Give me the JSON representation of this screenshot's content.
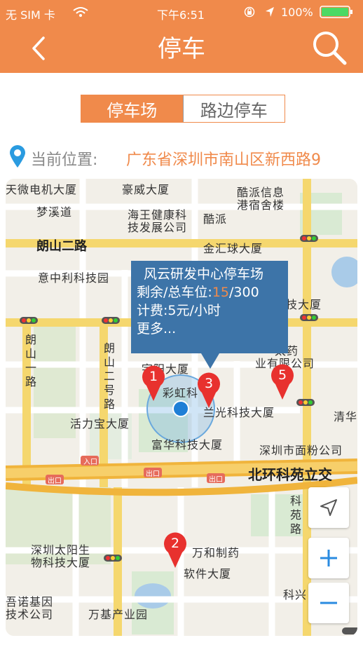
{
  "status_bar": {
    "carrier": "无 SIM 卡",
    "time": "下午6:51",
    "battery": "100%"
  },
  "nav": {
    "title": "停车"
  },
  "tabs": [
    {
      "label": "停车场"
    },
    {
      "label": "路边停车"
    }
  ],
  "location": {
    "label": "当前位置:",
    "value": "广东省深圳市南山区新西路9"
  },
  "map": {
    "labels": [
      "天微电机大厦",
      "豪威大厦",
      "酷派信息",
      "港宿舍楼",
      "梦溪道",
      "海王健康科",
      "技发展公司",
      "酷派",
      "朗山二路",
      "金汇球大厦",
      "意中利科技园",
      "技大厦",
      "太药",
      "业有限公司",
      "朗山一路",
      "朗山二号路",
      "宇阳大厦",
      "彩虹科",
      "兰光科技大厦",
      "活力宝大厦",
      "富华科技大厦",
      "深圳市面粉公司",
      "清华",
      "北环科苑立交",
      "科苑路",
      "深圳太阳生",
      "物科技大厦",
      "万和制药",
      "软件大厦",
      "吾诺基因",
      "技术公司",
      "万基产业园",
      "科兴",
      "入口",
      "出口",
      "出口",
      "出口"
    ]
  },
  "callout": {
    "title": "风云研发中心停车场",
    "spaces_label": "剩余/总车位:",
    "spaces_free": "15",
    "spaces_total": "/300",
    "fee": "计费:5元/小时",
    "more": "更多..."
  },
  "pins": [
    {
      "label": "1"
    },
    {
      "label": "2"
    },
    {
      "label": "3"
    },
    {
      "label": "5"
    }
  ],
  "icons": [
    "back-icon",
    "search-icon",
    "location-pin-icon",
    "locate-arrow-icon",
    "zoom-in-icon",
    "zoom-out-icon"
  ],
  "colors": {
    "accent": "#f08a4b",
    "callout": "#3d74a8",
    "pin": "#e8312e"
  }
}
